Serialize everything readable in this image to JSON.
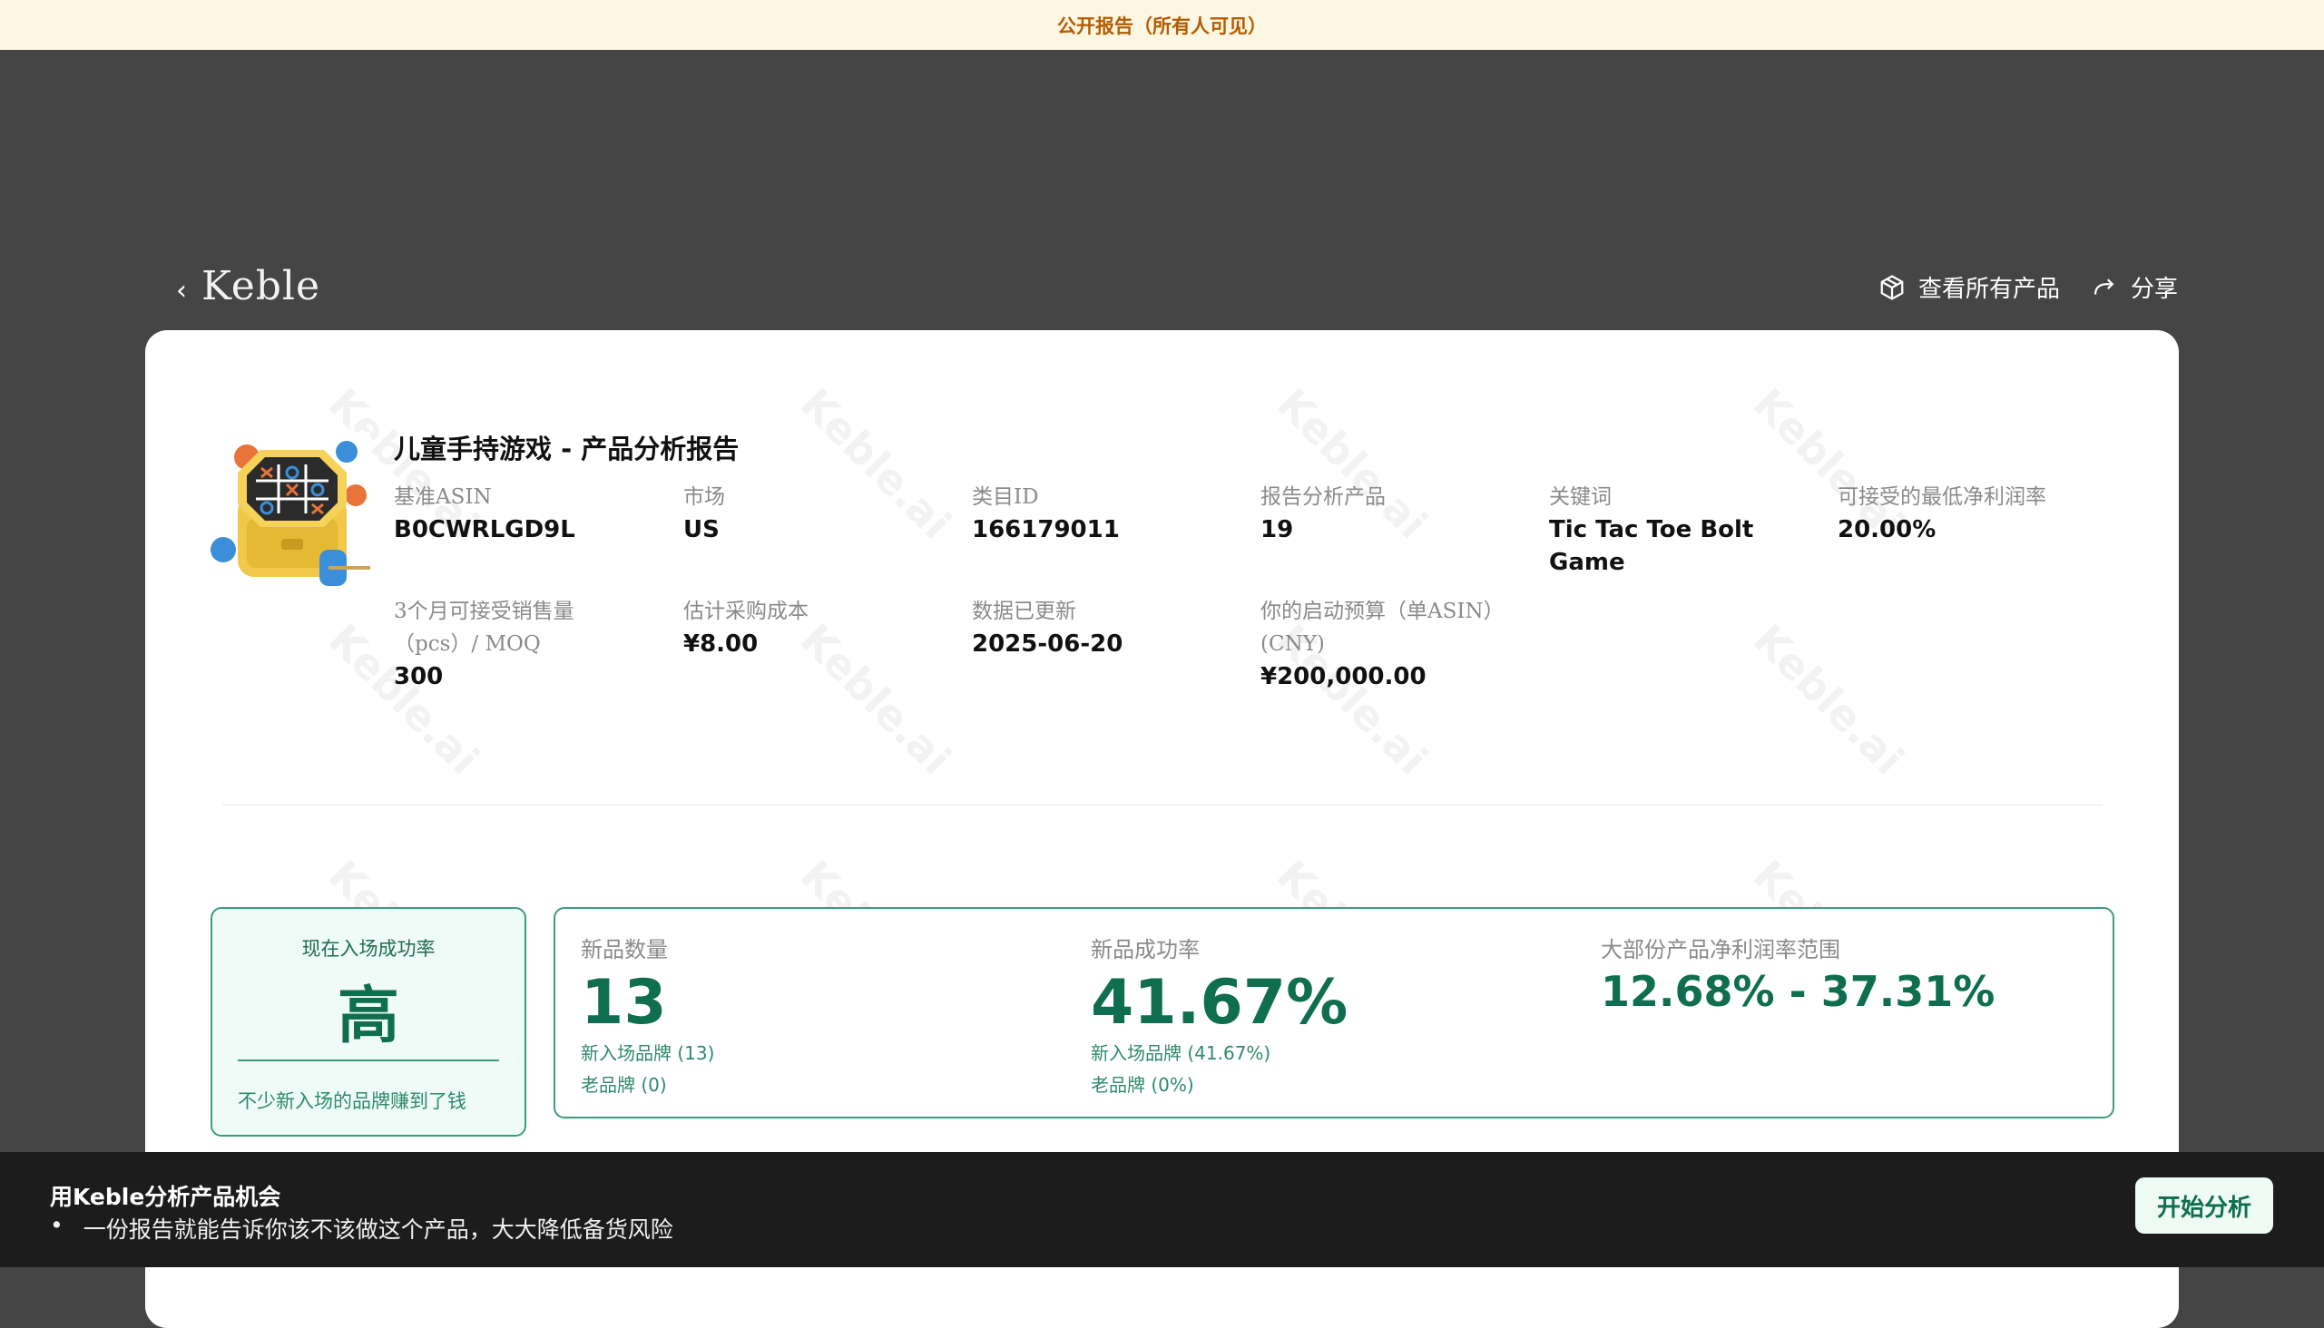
{
  "banner": {
    "text": "公开报告（所有人可见）"
  },
  "header": {
    "logo": "Keble",
    "view_all_label": "查看所有产品",
    "share_label": "分享"
  },
  "watermark": "Keble.ai",
  "report": {
    "title": "儿童手持游戏 - 产品分析报告",
    "fields": [
      {
        "label": "基准ASIN",
        "value": "B0CWRLGD9L"
      },
      {
        "label": "市场",
        "value": "US"
      },
      {
        "label": "类目ID",
        "value": "166179011"
      },
      {
        "label": "报告分析产品",
        "value": "19"
      },
      {
        "label": "关键词",
        "value": "Tic Tac Toe Bolt Game"
      },
      {
        "label": "可接受的最低净利润率",
        "value": "20.00%"
      },
      {
        "label": "3个月可接受销售量（pcs）/ MOQ",
        "value": "300"
      },
      {
        "label": "估计采购成本",
        "value": "¥8.00"
      },
      {
        "label": "数据已更新",
        "value": "2025-06-20"
      },
      {
        "label": "你的启动预算（单ASIN）(CNY)",
        "value": "¥200,000.00"
      }
    ]
  },
  "success": {
    "label": "现在入场成功率",
    "value": "高",
    "note": "不少新入场的品牌赚到了钱"
  },
  "stats": {
    "new_count": {
      "label": "新品数量",
      "value": "13",
      "sub1": "新入场品牌 (13)",
      "sub2": "老品牌 (0)"
    },
    "success_rate": {
      "label": "新品成功率",
      "value": "41.67%",
      "sub1": "新入场品牌 (41.67%)",
      "sub2": "老品牌 (0%)"
    },
    "margin_range": {
      "label": "大部份产品净利润率范围",
      "value": "12.68% - 37.31%"
    }
  },
  "cta": {
    "title": "用Keble分析产品机会",
    "bullet": "•",
    "description": "一份报告就能告诉你该不该做这个产品，大大降低备货风险",
    "button": "开始分析"
  },
  "colors": {
    "accent_green": "#0e6e4f",
    "border_green": "#3d9c7e",
    "banner_bg": "#fdf6e3",
    "banner_text": "#b35c00"
  }
}
